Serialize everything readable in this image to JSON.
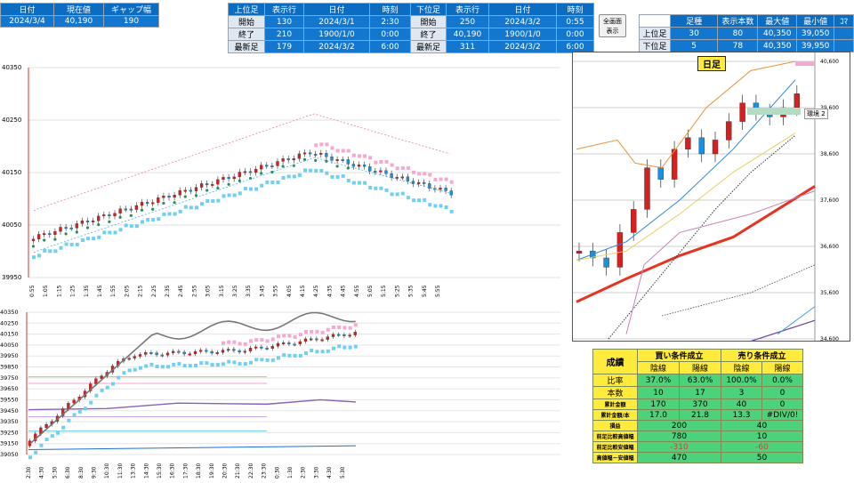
{
  "header_left": {
    "labels": [
      "日付",
      "現在値",
      "ギャップ幅"
    ],
    "values": [
      "2024/3/4",
      "40,190",
      "190"
    ]
  },
  "header_mid": {
    "cols": [
      "上位足",
      "表示行",
      "日付",
      "時刻"
    ],
    "rows": [
      {
        "label": "開始",
        "row": "130",
        "date": "2024/3/1",
        "time": "2:30"
      },
      {
        "label": "終了",
        "row": "210",
        "date": "1900/1/0",
        "time": "0:00"
      },
      {
        "label": "最新足",
        "row": "179",
        "date": "2024/3/2",
        "time": "6:00"
      }
    ]
  },
  "header_mid2": {
    "cols": [
      "下位足",
      "表示行",
      "日付",
      "時刻"
    ],
    "rows": [
      {
        "label": "開始",
        "row": "250",
        "date": "2024/3/2",
        "time": "0:55"
      },
      {
        "label": "終了",
        "row": "40,190",
        "date": "1900/1/0",
        "time": "0:00"
      },
      {
        "label": "最新足",
        "row": "311",
        "date": "2024/3/2",
        "time": "6:00"
      }
    ]
  },
  "fullscreen_button": "全画面\n表示",
  "header_right": {
    "cols": [
      "足種",
      "表示本数",
      "最大値",
      "最小値",
      "ｺﾏ"
    ],
    "rows": [
      {
        "label": "上位足",
        "a": "30",
        "b": "80",
        "max": "40,350",
        "min": "39,050"
      },
      {
        "label": "下位足",
        "a": "5",
        "b": "78",
        "max": "40,350",
        "min": "39,950"
      }
    ]
  },
  "main_chart": {
    "y_ticks": [
      "40350",
      "40250",
      "40150",
      "40050",
      "39950"
    ],
    "x_ticks": [
      "0:55",
      "1:05",
      "1:15",
      "1:25",
      "1:35",
      "1:45",
      "1:55",
      "2:05",
      "2:15",
      "2:25",
      "2:35",
      "2:45",
      "2:55",
      "3:05",
      "3:15",
      "3:25",
      "3:35",
      "3:45",
      "3:55",
      "4:05",
      "4:15",
      "4:25",
      "4:35",
      "4:45",
      "4:55",
      "5:05",
      "5:15",
      "5:25",
      "5:35",
      "5:45",
      "5:55"
    ]
  },
  "lower_chart": {
    "y_ticks": [
      "40350",
      "40250",
      "40150",
      "40050",
      "39950",
      "39850",
      "39750",
      "39650",
      "39550",
      "39450",
      "39350",
      "39250",
      "39150",
      "39050"
    ],
    "x_ticks": [
      "2:30",
      "4:30",
      "5:30",
      "6:30",
      "8:30",
      "9:30",
      "10:30",
      "11:30",
      "13:30",
      "14:30",
      "15:30",
      "16:30",
      "17:30",
      "18:30",
      "19:30",
      "20:30",
      "21:30",
      "22:30",
      "23:30",
      "0:30",
      "1:30",
      "2:30",
      "3:30",
      "4:30",
      "5:30"
    ]
  },
  "daily_chart": {
    "title": "日足",
    "y_ticks": [
      "40,600",
      "39,600",
      "38,600",
      "37,600",
      "36,600",
      "35,600",
      "34,600"
    ],
    "tooltip": "環境 2"
  },
  "stats": {
    "title": "成績",
    "buy": "買い条件成立",
    "sell": "売り条件成立",
    "sub": [
      "陰線",
      "陽線",
      "陰線",
      "陽線"
    ],
    "rows": [
      {
        "label": "比率",
        "vals": [
          "37.0%",
          "63.0%",
          "100.0%",
          "0.0%"
        ]
      },
      {
        "label": "本数",
        "vals": [
          "10",
          "17",
          "3",
          "0"
        ]
      },
      {
        "label": "累計金額",
        "vals": [
          "170",
          "370",
          "40",
          "0"
        ]
      },
      {
        "label": "累計金額/本",
        "vals": [
          "17.0",
          "21.8",
          "13.3",
          "#DIV/0!"
        ]
      }
    ],
    "rows2": [
      {
        "label": "損益",
        "a": "200",
        "b": "40"
      },
      {
        "label": "前足比較高値幅",
        "a": "780",
        "b": "10"
      },
      {
        "label": "前足比較安値幅",
        "a": "-310",
        "b": "-60"
      },
      {
        "label": "高値幅－安値幅",
        "a": "470",
        "b": "50"
      }
    ]
  }
}
